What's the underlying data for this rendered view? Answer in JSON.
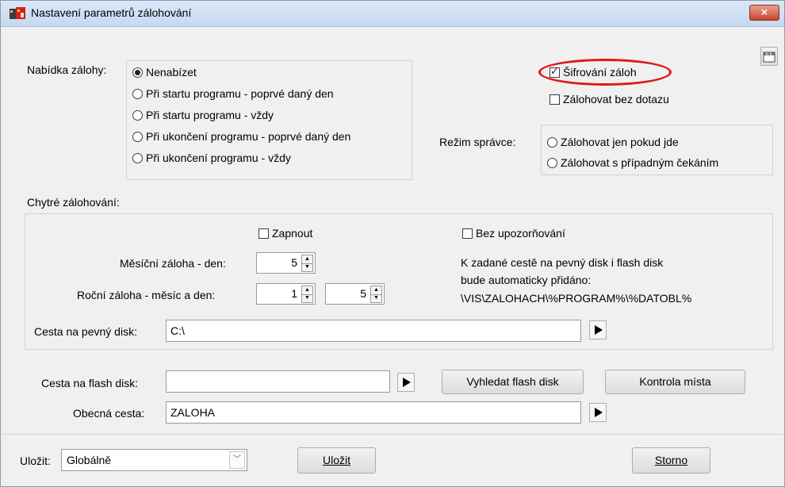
{
  "window": {
    "title": "Nastavení parametrů zálohování",
    "close_label": "×"
  },
  "offer": {
    "label": "Nabídka zálohy:",
    "options": [
      {
        "label": "Nenabízet",
        "selected": true
      },
      {
        "label": "Při startu programu - poprvé daný den",
        "selected": false
      },
      {
        "label": "Při startu programu - vždy",
        "selected": false
      },
      {
        "label": "Při ukončení programu - poprvé daný den",
        "selected": false
      },
      {
        "label": "Při ukončení programu - vždy",
        "selected": false
      }
    ]
  },
  "options": {
    "encrypt_label": "Šifrování záloh",
    "encrypt_checked": true,
    "no_prompt_label": "Zálohovat bez dotazu",
    "no_prompt_checked": false
  },
  "admin": {
    "label": "Režim správce:",
    "options": [
      {
        "label": "Zálohovat jen pokud jde",
        "selected": false
      },
      {
        "label": "Zálohovat s případným čekáním",
        "selected": false
      }
    ]
  },
  "smart": {
    "label": "Chytré zálohování:",
    "enable_label": "Zapnout",
    "no_warn_label": "Bez upozorňování",
    "monthly_label": "Měsíční záloha - den:",
    "monthly_day": "5",
    "yearly_label": "Roční záloha - měsíc a den:",
    "yearly_month": "1",
    "yearly_day": "5",
    "info_line1": "K zadané cestě na pevný disk i flash disk",
    "info_line2": "bude automaticky přidáno:",
    "info_line3": "\\VIS\\ZALOHACH\\%PROGRAM%\\%DATOBL%",
    "hdd_label": "Cesta na pevný disk:",
    "hdd_value": "C:\\"
  },
  "flash": {
    "label": "Cesta na flash disk:",
    "value": "",
    "find_button": "Vyhledat flash disk",
    "check_button": "Kontrola místa"
  },
  "general": {
    "label": "Obecná cesta:",
    "value": "ZALOHA"
  },
  "footer": {
    "save_label": "Uložit:",
    "save_scope": "Globálně",
    "save_button": "Uložit",
    "cancel_button": "Storno"
  }
}
